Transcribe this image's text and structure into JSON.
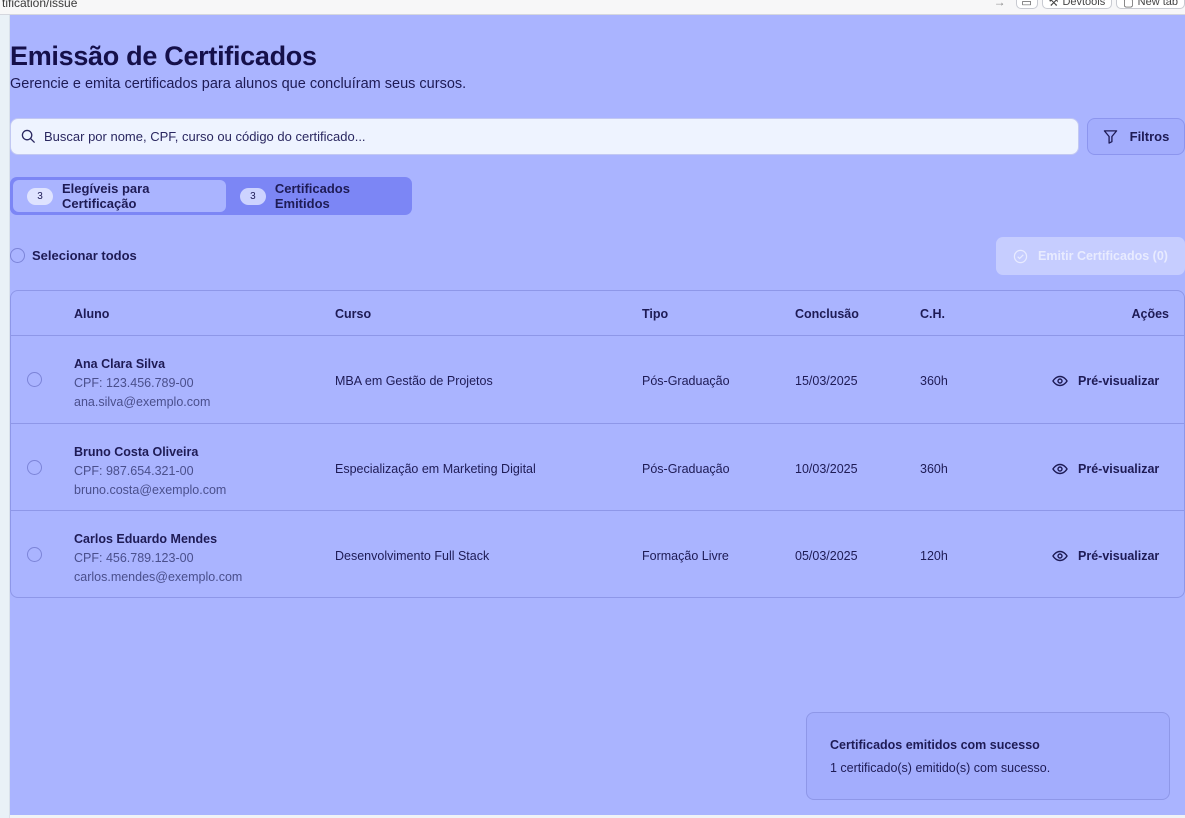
{
  "browser": {
    "url": "tification/issue",
    "devtools_label": "Devtools",
    "new_tab_label": "New tab"
  },
  "header": {
    "title": "Emissão de Certificados",
    "subtitle": "Gerencie e emita certificados para alunos que concluíram seus cursos."
  },
  "search": {
    "placeholder": "Buscar por nome, CPF, curso ou código do certificado...",
    "value": ""
  },
  "filters": {
    "label": "Filtros"
  },
  "tabs": [
    {
      "count": "3",
      "label": "Elegíveis para Certificação",
      "active": true
    },
    {
      "count": "3",
      "label": "Certificados Emitidos",
      "active": false
    }
  ],
  "selection": {
    "select_all_label": "Selecionar todos",
    "emit_button_label": "Emitir Certificados (0)"
  },
  "table": {
    "headers": [
      "Aluno",
      "Curso",
      "Tipo",
      "Conclusão",
      "C.H.",
      "Ações"
    ],
    "rows": [
      {
        "name": "Ana Clara Silva",
        "cpf": "CPF: 123.456.789-00",
        "email": "ana.silva@exemplo.com",
        "course": "MBA em Gestão de Projetos",
        "type": "Pós-Graduação",
        "date": "15/03/2025",
        "hours": "360h",
        "action": "Pré-visualizar"
      },
      {
        "name": "Bruno Costa Oliveira",
        "cpf": "CPF: 987.654.321-00",
        "email": "bruno.costa@exemplo.com",
        "course": "Especialização em Marketing Digital",
        "type": "Pós-Graduação",
        "date": "10/03/2025",
        "hours": "360h",
        "action": "Pré-visualizar"
      },
      {
        "name": "Carlos Eduardo Mendes",
        "cpf": "CPF: 456.789.123-00",
        "email": "carlos.mendes@exemplo.com",
        "course": "Desenvolvimento Full Stack",
        "type": "Formação Livre",
        "date": "05/03/2025",
        "hours": "120h",
        "action": "Pré-visualizar"
      }
    ]
  },
  "toast": {
    "title": "Certificados emitidos com sucesso",
    "message": "1 certificado(s) emitido(s) com sucesso."
  },
  "icons": {
    "search": "search-icon",
    "filter": "filter-icon",
    "emit": "check-circle-icon",
    "preview": "eye-icon"
  },
  "colors": {
    "overlay": "#aab4ff",
    "title": "#15104a",
    "tabs_bg": "#7c86f5",
    "emit_disabled": "#c6cdff"
  }
}
